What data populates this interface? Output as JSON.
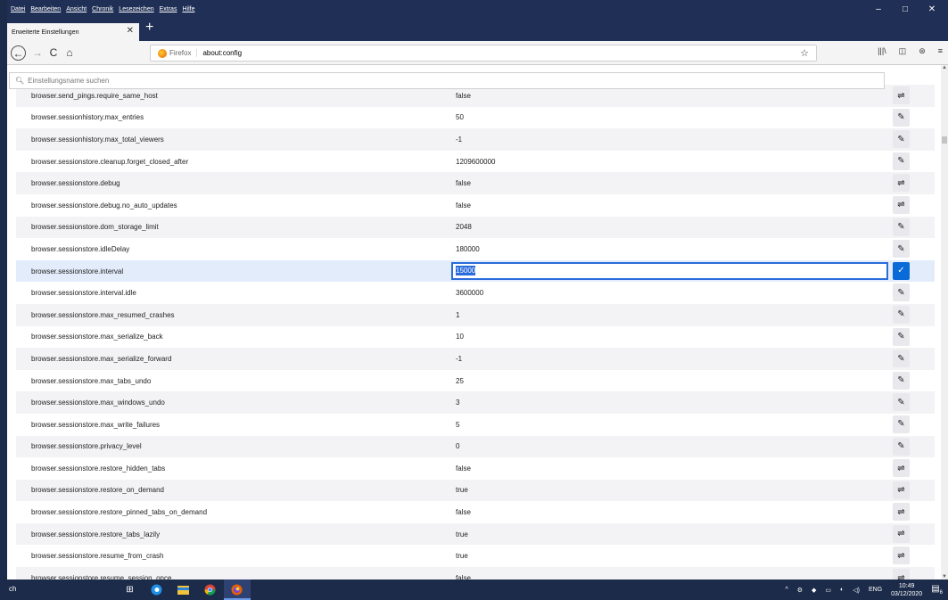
{
  "window": {
    "menu": [
      "Datei",
      "Bearbeiten",
      "Ansicht",
      "Chronik",
      "Lesezeichen",
      "Extras",
      "Hilfe"
    ],
    "controls": {
      "minimize": "–",
      "maximize": "□",
      "close": "✕"
    }
  },
  "tab": {
    "title": "Erweiterte Einstellungen",
    "close": "✕",
    "new_tab": "+"
  },
  "navbar": {
    "back": "←",
    "forward": "→",
    "reload": "C",
    "home": "⌂",
    "identity": "Firefox",
    "url": "about:config",
    "bookmark_star": "☆",
    "library": "|||\\",
    "sidebar": "◫",
    "account": "⊛",
    "menu": "≡"
  },
  "config": {
    "search_placeholder": "Einstellungsname suchen",
    "rows": [
      {
        "name": "browser.send_pings.require_same_host",
        "value": "false",
        "action": "toggle"
      },
      {
        "name": "browser.sessionhistory.max_entries",
        "value": "50",
        "action": "edit"
      },
      {
        "name": "browser.sessionhistory.max_total_viewers",
        "value": "-1",
        "action": "edit"
      },
      {
        "name": "browser.sessionstore.cleanup.forget_closed_after",
        "value": "1209600000",
        "action": "edit"
      },
      {
        "name": "browser.sessionstore.debug",
        "value": "false",
        "action": "toggle"
      },
      {
        "name": "browser.sessionstore.debug.no_auto_updates",
        "value": "false",
        "action": "toggle"
      },
      {
        "name": "browser.sessionstore.dom_storage_limit",
        "value": "2048",
        "action": "edit"
      },
      {
        "name": "browser.sessionstore.idleDelay",
        "value": "180000",
        "action": "edit"
      },
      {
        "name": "browser.sessionstore.interval",
        "value": "15000",
        "action": "save"
      },
      {
        "name": "browser.sessionstore.interval.idle",
        "value": "3600000",
        "action": "edit"
      },
      {
        "name": "browser.sessionstore.max_resumed_crashes",
        "value": "1",
        "action": "edit"
      },
      {
        "name": "browser.sessionstore.max_serialize_back",
        "value": "10",
        "action": "edit"
      },
      {
        "name": "browser.sessionstore.max_serialize_forward",
        "value": "-1",
        "action": "edit"
      },
      {
        "name": "browser.sessionstore.max_tabs_undo",
        "value": "25",
        "action": "edit"
      },
      {
        "name": "browser.sessionstore.max_windows_undo",
        "value": "3",
        "action": "edit"
      },
      {
        "name": "browser.sessionstore.max_write_failures",
        "value": "5",
        "action": "edit"
      },
      {
        "name": "browser.sessionstore.privacy_level",
        "value": "0",
        "action": "edit"
      },
      {
        "name": "browser.sessionstore.restore_hidden_tabs",
        "value": "false",
        "action": "toggle"
      },
      {
        "name": "browser.sessionstore.restore_on_demand",
        "value": "true",
        "action": "toggle"
      },
      {
        "name": "browser.sessionstore.restore_pinned_tabs_on_demand",
        "value": "false",
        "action": "toggle"
      },
      {
        "name": "browser.sessionstore.restore_tabs_lazily",
        "value": "true",
        "action": "toggle"
      },
      {
        "name": "browser.sessionstore.resume_from_crash",
        "value": "true",
        "action": "toggle"
      },
      {
        "name": "browser.sessionstore.resume_session_once",
        "value": "false",
        "action": "toggle"
      }
    ],
    "selected_index": 8,
    "action_glyphs": {
      "toggle": "⇌",
      "edit": "✎",
      "save": "✓"
    }
  },
  "taskbar": {
    "search_text": "ch",
    "task_view": "⊞",
    "clock_time": "10:49",
    "clock_date": "03/12/2020",
    "lang": "ENG",
    "tray_icons": [
      "^",
      "⚙",
      "◆",
      "▭",
      "◐",
      "◁)"
    ],
    "notification_count": "6",
    "colors": {
      "taskbar": "#1c2b4a",
      "selection": "#2a6cdb",
      "accent": "#0a6ad8"
    }
  }
}
